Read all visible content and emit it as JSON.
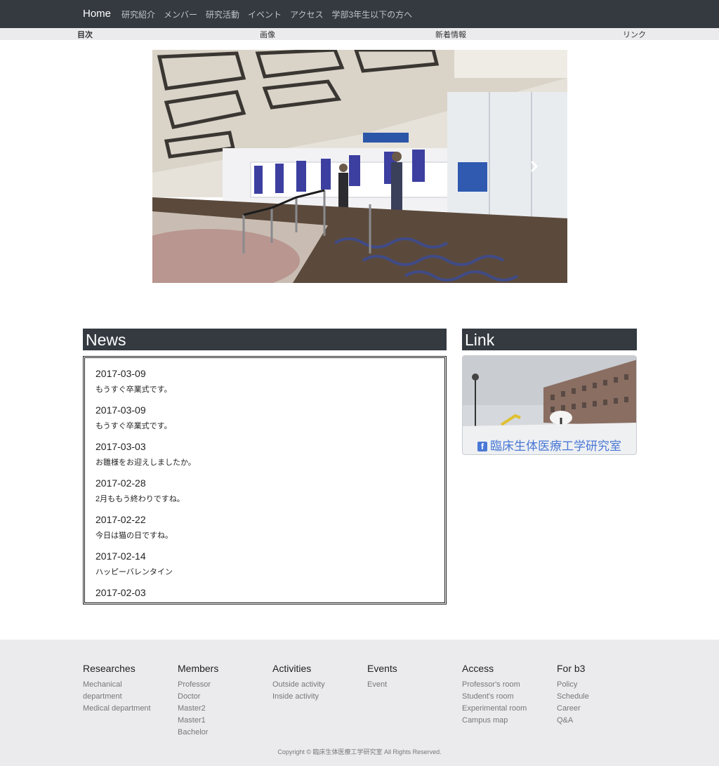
{
  "navbar": {
    "brand": "Home",
    "links": [
      "研究紹介",
      "メンバー",
      "研究活動",
      "イベント",
      "アクセス",
      "学部3年生以下の方へ"
    ]
  },
  "subnav": {
    "items": [
      "目次",
      "画像",
      "新着情報",
      "リンク"
    ]
  },
  "hero": {
    "next_icon": "chevron-right-icon"
  },
  "news": {
    "title": "News",
    "items": [
      {
        "date": "2017-03-09",
        "text": "もうすぐ卒業式です。"
      },
      {
        "date": "2017-03-09",
        "text": "もうすぐ卒業式です。"
      },
      {
        "date": "2017-03-03",
        "text": "お雛様をお迎えしましたか。"
      },
      {
        "date": "2017-02-28",
        "text": "2月ももう終わりですね。"
      },
      {
        "date": "2017-02-22",
        "text": "今日は猫の日ですね。"
      },
      {
        "date": "2017-02-14",
        "text": "ハッピーバレンタイン"
      },
      {
        "date": "2017-02-03",
        "text": ""
      }
    ]
  },
  "link_panel": {
    "title": "Link",
    "card_label": "臨床生体医療工学研究室",
    "card_icon": "facebook-icon"
  },
  "footer": {
    "columns": [
      {
        "title": "Researches",
        "links": [
          "Mechanical department",
          "Medical department"
        ]
      },
      {
        "title": "Members",
        "links": [
          "Professor",
          "Doctor",
          "Master2",
          "Master1",
          "Bachelor"
        ]
      },
      {
        "title": "Activities",
        "links": [
          "Outside activity",
          "Inside activity"
        ]
      },
      {
        "title": "Events",
        "links": [
          "Event"
        ]
      },
      {
        "title": "Access",
        "links": [
          "Professor's room",
          "Student's room",
          "Experimental room",
          "Campus map"
        ]
      },
      {
        "title": "For b3",
        "links": [
          "Policy",
          "Schedule",
          "Career",
          "Q&A"
        ]
      }
    ],
    "copyright": "Copyright © 臨床生体医療工学研究室 All Rights Reserved."
  },
  "colors": {
    "navbar_bg": "#343a40",
    "panel_head_bg": "#343a40",
    "footer_bg": "#ebebed",
    "link_blue": "#4a78d6"
  }
}
